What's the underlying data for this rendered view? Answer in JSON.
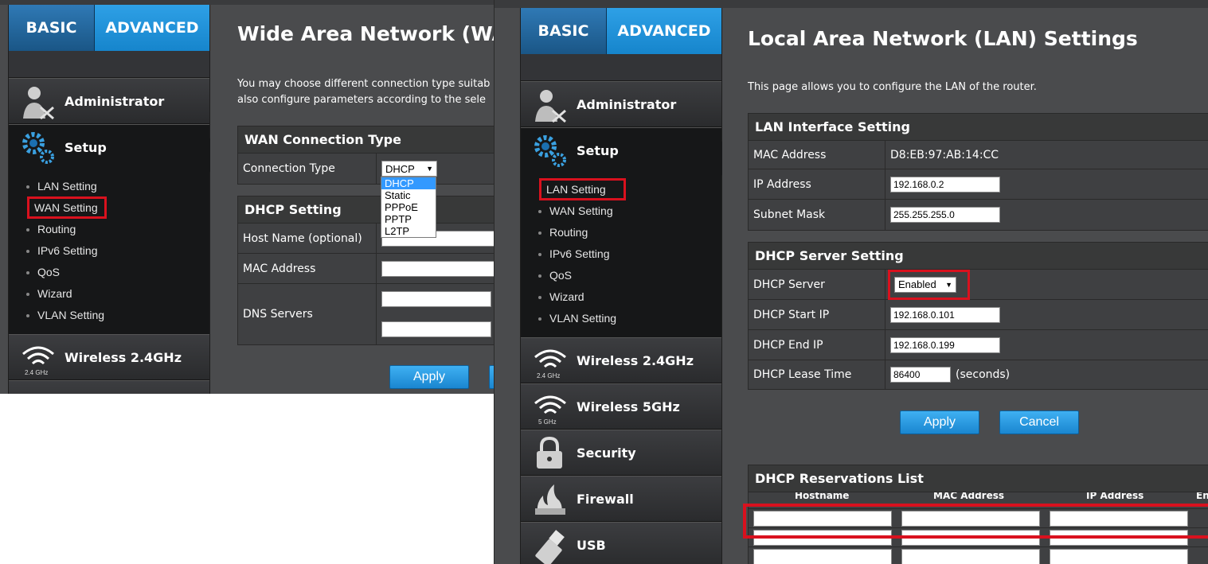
{
  "left": {
    "tabs": {
      "basic": "BASIC",
      "advanced": "ADVANCED"
    },
    "nav": {
      "administrator": "Administrator",
      "setup": "Setup",
      "wireless24": "Wireless 2.4GHz",
      "wireless24_sub": "2.4 GHz"
    },
    "submenu": [
      "LAN Setting",
      "WAN Setting",
      "Routing",
      "IPv6 Setting",
      "QoS",
      "Wizard",
      "VLAN Setting"
    ],
    "title": "Wide Area Network (WA",
    "desc_line1": "You may choose different connection type suitab",
    "desc_line2": "also configure parameters according to the sele",
    "wan_panel": {
      "heading": "WAN Connection Type",
      "label": "Connection Type",
      "selected": "DHCP",
      "options": [
        "DHCP",
        "Static",
        "PPPoE",
        "PPTP",
        "L2TP"
      ]
    },
    "dhcp_panel": {
      "heading": "DHCP Setting",
      "host_name": "Host Name (optional)",
      "mac": "MAC Address",
      "dns": "DNS Servers"
    },
    "apply": "Apply"
  },
  "right": {
    "tabs": {
      "basic": "BASIC",
      "advanced": "ADVANCED"
    },
    "nav": {
      "administrator": "Administrator",
      "setup": "Setup",
      "wireless24": "Wireless 2.4GHz",
      "wireless24_sub": "2.4 GHz",
      "wireless5": "Wireless 5GHz",
      "wireless5_sub": "5 GHz",
      "security": "Security",
      "firewall": "Firewall",
      "usb": "USB"
    },
    "submenu": [
      "LAN Setting",
      "WAN Setting",
      "Routing",
      "IPv6 Setting",
      "QoS",
      "Wizard",
      "VLAN Setting"
    ],
    "title": "Local Area Network (LAN) Settings",
    "desc": "This page allows you to configure the LAN of the router.",
    "lan_panel": {
      "heading": "LAN Interface Setting",
      "mac_label": "MAC Address",
      "mac_value": "D8:EB:97:AB:14:CC",
      "ip_label": "IP Address",
      "ip_value": "192.168.0.2",
      "mask_label": "Subnet Mask",
      "mask_value": "255.255.255.0"
    },
    "dhcp_panel": {
      "heading": "DHCP Server Setting",
      "server_label": "DHCP Server",
      "server_value": "Enabled",
      "start_label": "DHCP Start IP",
      "start_value": "192.168.0.101",
      "end_label": "DHCP End IP",
      "end_value": "192.168.0.199",
      "lease_label": "DHCP Lease Time",
      "lease_value": "86400",
      "lease_unit": "(seconds)"
    },
    "apply": "Apply",
    "cancel": "Cancel",
    "reservations": {
      "heading": "DHCP Reservations List",
      "col_hostname": "Hostname",
      "col_mac": "MAC Address",
      "col_ip": "IP Address",
      "col_en": "En"
    }
  },
  "colors": {
    "highlight": "#d9111e",
    "accent": "#1685cc",
    "sidebar": "#2b2c2e",
    "content": "#4a4b4d"
  }
}
